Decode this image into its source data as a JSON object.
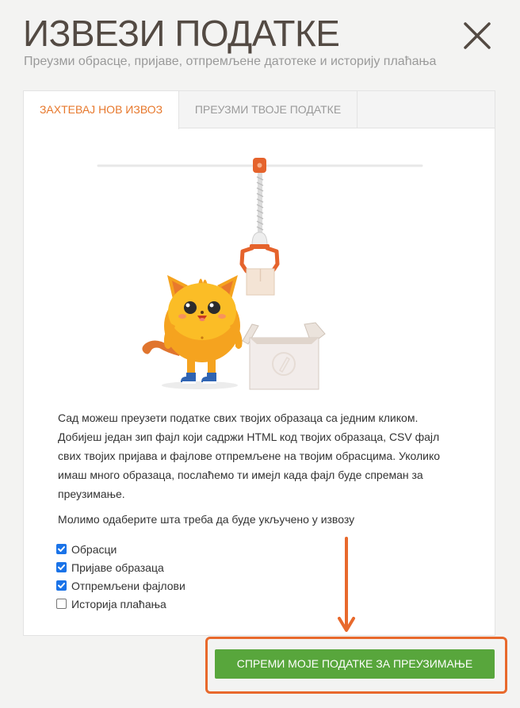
{
  "header": {
    "title": "ИЗВЕЗИ ПОДАТКЕ",
    "subtitle": "Преузми обрасце, пријаве, отпремљене датотеке и историју плаћања",
    "close_icon": "close-icon"
  },
  "tabs": [
    {
      "label": "ЗАХТЕВАЈ НОВ ИЗВОЗ",
      "active": true
    },
    {
      "label": "ПРЕУЗМИ ТВОЈЕ ПОДАТКЕ",
      "active": false
    }
  ],
  "content": {
    "description": "Сад можеш преузети податке свих твојих образаца са једним кликом. Добијеш један зип фајл који садржи HTML код твојих образаца, CSV фајл свих твојих пријава и фајлове отпремљене на твојим обрасцима. Уколико имаш много образаца, послаћемо ти имејл када фајл буде спреман за преузимање.",
    "instruction": "Молимо одаберите шта треба да буде укључено у извозу",
    "options": [
      {
        "label": "Обрасци",
        "checked": true
      },
      {
        "label": "Пријаве образаца",
        "checked": true
      },
      {
        "label": "Отпремљени фајлови",
        "checked": true
      },
      {
        "label": "Историја плаћања",
        "checked": false
      }
    ]
  },
  "action": {
    "download_label": "СПРЕМИ МОЈЕ ПОДАТКЕ ЗА ПРЕУЗИМАЊЕ"
  },
  "colors": {
    "accent": "#e7782c",
    "button": "#58a63c",
    "highlight": "#e8692c",
    "checkbox": "#1a73e8"
  }
}
